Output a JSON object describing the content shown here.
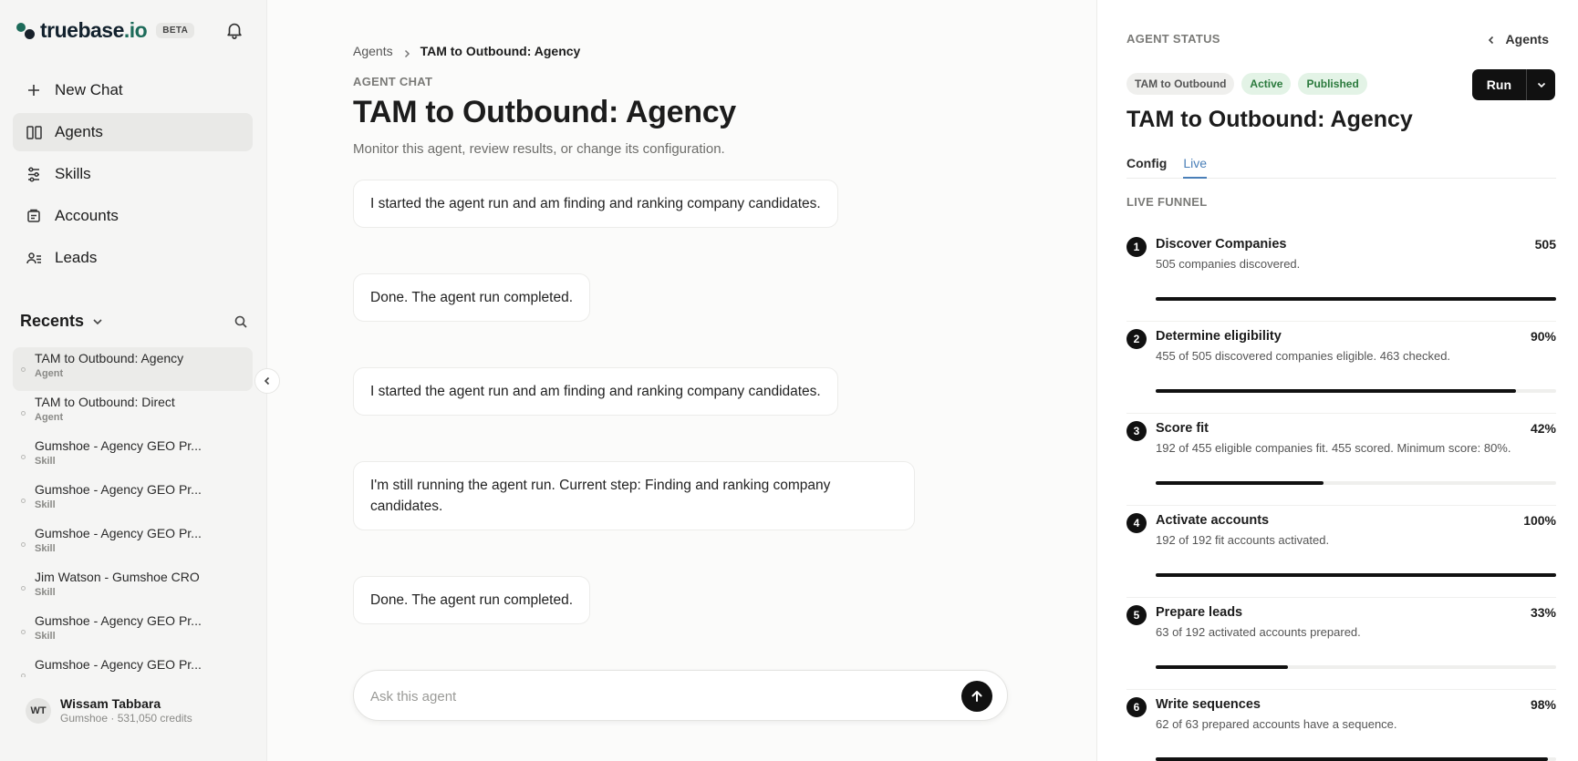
{
  "sidebar": {
    "brand": {
      "name": "truebase",
      "tld": ".io",
      "badge": "BETA"
    },
    "nav": [
      {
        "label": "New Chat",
        "icon": "plus-icon"
      },
      {
        "label": "Agents",
        "icon": "agents-icon",
        "active": true
      },
      {
        "label": "Skills",
        "icon": "sliders-icon"
      },
      {
        "label": "Accounts",
        "icon": "accounts-icon"
      },
      {
        "label": "Leads",
        "icon": "leads-icon"
      }
    ],
    "recents_label": "Recents",
    "recents": [
      {
        "name": "TAM to Outbound: Agency",
        "type": "Agent",
        "active": true
      },
      {
        "name": "TAM to Outbound: Direct",
        "type": "Agent"
      },
      {
        "name": "Gumshoe - Agency GEO Pr...",
        "type": "Skill"
      },
      {
        "name": "Gumshoe - Agency GEO Pr...",
        "type": "Skill"
      },
      {
        "name": "Gumshoe - Agency GEO Pr...",
        "type": "Skill"
      },
      {
        "name": "Jim Watson - Gumshoe CRO",
        "type": "Skill"
      },
      {
        "name": "Gumshoe - Agency GEO Pr...",
        "type": "Skill"
      },
      {
        "name": "Gumshoe - Agency GEO Pr...",
        "type": ""
      }
    ],
    "user": {
      "initials": "WT",
      "name": "Wissam Tabbara",
      "meta": "Gumshoe · 531,050 credits"
    }
  },
  "main": {
    "breadcrumb": {
      "root": "Agents",
      "current": "TAM to Outbound: Agency"
    },
    "eyebrow": "AGENT CHAT",
    "title": "TAM to Outbound: Agency",
    "subtitle": "Monitor this agent, review results, or change its configuration.",
    "messages": [
      "I started the agent run and am finding and ranking company candidates.",
      "Done. The agent run completed.",
      "I started the agent run and am finding and ranking company candidates.",
      "I'm still running the agent run. Current step: Finding and ranking company candidates.",
      "Done. The agent run completed."
    ],
    "composer": {
      "placeholder": "Ask this agent"
    }
  },
  "panel": {
    "eyebrow": "AGENT STATUS",
    "back_label": "Agents",
    "badges": [
      {
        "label": "TAM to Outbound",
        "tone": "gray"
      },
      {
        "label": "Active",
        "tone": "green"
      },
      {
        "label": "Published",
        "tone": "green"
      }
    ],
    "run_label": "Run",
    "title": "TAM to Outbound: Agency",
    "tabs": [
      {
        "label": "Config"
      },
      {
        "label": "Live",
        "active": true
      }
    ],
    "funnel_label": "LIVE FUNNEL",
    "steps": [
      {
        "num": "1",
        "name": "Discover Companies",
        "value": "505",
        "desc": "505 companies discovered.",
        "progress": 1.0
      },
      {
        "num": "2",
        "name": "Determine eligibility",
        "value": "90%",
        "desc": "455 of 505 discovered companies eligible. 463 checked.",
        "progress": 0.9
      },
      {
        "num": "3",
        "name": "Score fit",
        "value": "42%",
        "desc": "192 of 455 eligible companies fit. 455 scored. Minimum score: 80%.",
        "progress": 0.42
      },
      {
        "num": "4",
        "name": "Activate accounts",
        "value": "100%",
        "desc": "192 of 192 fit accounts activated.",
        "progress": 1.0
      },
      {
        "num": "5",
        "name": "Prepare leads",
        "value": "33%",
        "desc": "63 of 192 activated accounts prepared.",
        "progress": 0.33
      },
      {
        "num": "6",
        "name": "Write sequences",
        "value": "98%",
        "desc": "62 of 63 prepared accounts have a sequence.",
        "progress": 0.98
      }
    ]
  }
}
